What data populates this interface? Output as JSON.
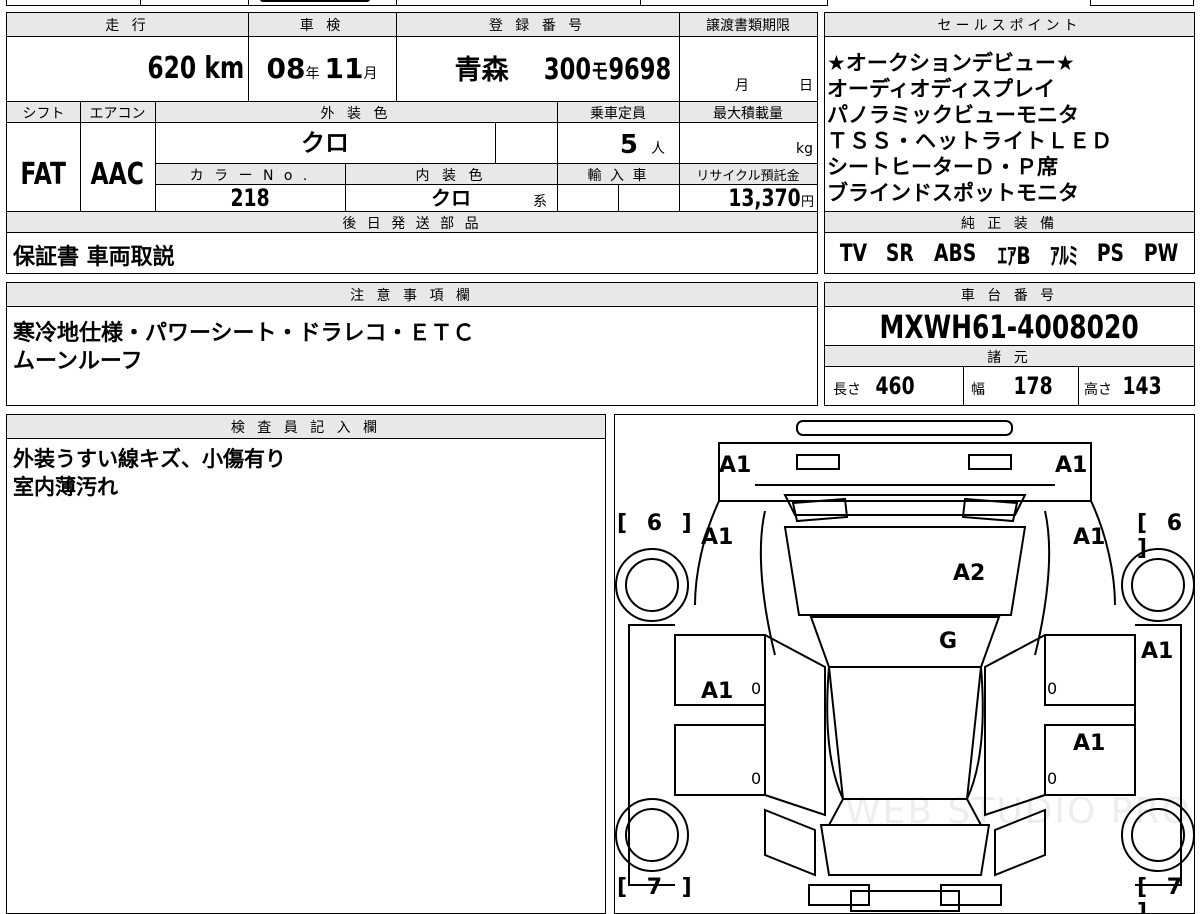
{
  "headers": {
    "mileage": "走 行",
    "inspection": "車 検",
    "registration": "登 録 番 号",
    "transfer_deadline": "譲渡書類期限",
    "sales_points": "セールスポイント",
    "shift": "シフト",
    "aircon": "エアコン",
    "exterior_color": "外 装 色",
    "capacity": "乗車定員",
    "max_load": "最大積載量",
    "color_no": "カ ラ ー N o .",
    "interior_color": "内 装 色",
    "import": "輸 入 車",
    "recycle": "リサイクル預託金",
    "later_parts": "後 日 発 送 部 品",
    "standard_equipment": "純 正 装 備",
    "notes": "注 意 事 項 欄",
    "chassis_no": "車 台 番 号",
    "specs": "諸 元",
    "inspector": "検 査 員 記 入 欄"
  },
  "mileage": {
    "value": "620",
    "unit": "km"
  },
  "inspection": {
    "year": "08",
    "year_unit": "年",
    "month": "11",
    "month_unit": "月"
  },
  "registration": {
    "place": "青森",
    "class": "300",
    "kana": "モ",
    "number": "9698"
  },
  "transfer_deadline": {
    "month_unit": "月",
    "day_unit": "日"
  },
  "shift": "FAT",
  "aircon": "AAC",
  "exterior_color": "クロ",
  "capacity": {
    "value": "5",
    "unit": "人"
  },
  "max_load": {
    "unit": "kg"
  },
  "color_no": "218",
  "interior_color": {
    "value": "クロ",
    "suffix": "系"
  },
  "recycle": {
    "value": "13,370",
    "unit": "円"
  },
  "sales_points": [
    "★オークションデビュー★",
    "オーディオディスプレイ",
    "パノラミックビューモニタ",
    "ＴＳＳ・ヘットライトＬＥＤ",
    "シートヒーターＤ・Ｐ席",
    "ブラインドスポットモニタ"
  ],
  "later_parts": "保証書 車両取説",
  "standard_equipment": [
    "TV",
    "SR",
    "ABS",
    "ｴｱB",
    "ｱﾙﾐ",
    "PS",
    "PW"
  ],
  "notes": [
    "寒冷地仕様・パワーシート・ドラレコ・ＥＴＣ",
    "ムーンルーフ"
  ],
  "chassis_no": "MXWH61-4008020",
  "specs": {
    "length_label": "長さ",
    "length": "460",
    "width_label": "幅",
    "width": "178",
    "height_label": "高さ",
    "height": "143"
  },
  "inspector_notes": [
    "外装うすい線キズ、小傷有り",
    "室内薄汚れ"
  ],
  "diagram": {
    "marks": {
      "front_left": "A1",
      "front_right": "A1",
      "fender_left": "A1",
      "fender_right": "A1",
      "hood": "A2",
      "windshield": "G",
      "front_door_left": "A1",
      "front_door_right_outer": "A1",
      "rear_door_right": "A1",
      "zero_1": "0",
      "zero_2": "0",
      "zero_3": "0",
      "zero_4": "0"
    },
    "tire_front_left": "[ 6 ]",
    "tire_front_right": "[ 6 ]",
    "tire_rear_left": "[ 7 ]",
    "tire_rear_right": "[ 7 ]",
    "watermark": "WEB STUDIO PRO"
  }
}
